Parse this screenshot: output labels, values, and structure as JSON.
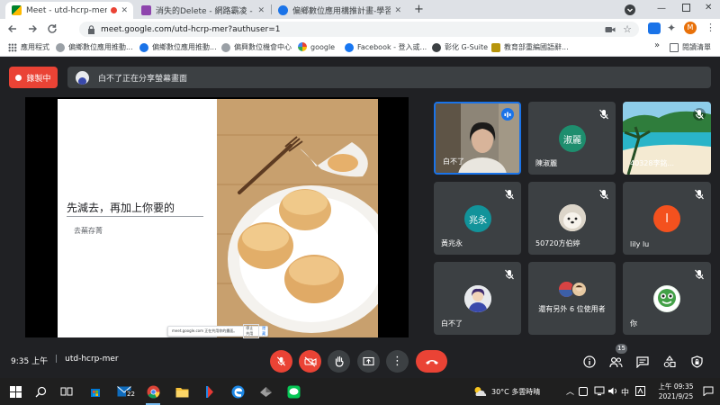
{
  "browser": {
    "tabs": [
      {
        "title": "Meet - utd-hcrp-mer",
        "active": true
      },
      {
        "title": "消失的Delete - 網路霸凌 - 網路",
        "active": false
      },
      {
        "title": "偏鄉數位應用構推計畫-學習中心",
        "active": false
      }
    ],
    "new_tab": "+",
    "url": "meet.google.com/utd-hcrp-mer?authuser=1",
    "profile_initial": "M",
    "bookmarks": [
      "應用程式",
      "偏鄉數位應用推動...",
      "偏鄉數位應用推動...",
      "偏興數位機會中心",
      "google",
      "Facebook - 登入或...",
      "彰化 G-Suite",
      "教育部重編國語辭..."
    ],
    "bookmarks_more": "»",
    "reading_list": "閱讀清單"
  },
  "meet": {
    "recording_label": "錄製中",
    "presenting_banner": "白不了正在分享螢幕畫面",
    "slide": {
      "title": "先減去，再加上你要的",
      "subtitle": "去蕪存菁",
      "share_bar_text": "meet.google.com 正在共用你的畫面。",
      "share_bar_stop": "停止共用",
      "share_bar_hide": "隱藏"
    },
    "participants": [
      {
        "name": "白不了",
        "type": "video",
        "speaking": true
      },
      {
        "name": "陳淑麗",
        "type": "avatar",
        "initials": "淑麗",
        "color": "#1e8e6e"
      },
      {
        "name": "40328李銘...",
        "type": "photo"
      },
      {
        "name": "黃兆永",
        "type": "avatar",
        "initials": "兆永",
        "color": "#12939a"
      },
      {
        "name": "50720方伯婷",
        "type": "photo"
      },
      {
        "name": "lily lu",
        "type": "avatar",
        "initials": "l",
        "color": "#f4511e"
      },
      {
        "name": "白不了",
        "type": "photo"
      },
      {
        "name": "還有另外 6 位使用者",
        "type": "group"
      },
      {
        "name": "你",
        "type": "photo"
      }
    ],
    "time": "9:35 上午",
    "separator": "|",
    "meeting_code": "utd-hcrp-mer",
    "people_count": "15",
    "colors": {
      "record_red": "#ea4335",
      "hangup_red": "#ea4335",
      "speaking_blue": "#1a73e8",
      "tile_bg": "#3c4043"
    }
  },
  "taskbar": {
    "weather": "30°C 多雲時晴",
    "ime": "中",
    "time": "上午 09:35",
    "date": "2021/9/25",
    "mail_badge": "22"
  }
}
